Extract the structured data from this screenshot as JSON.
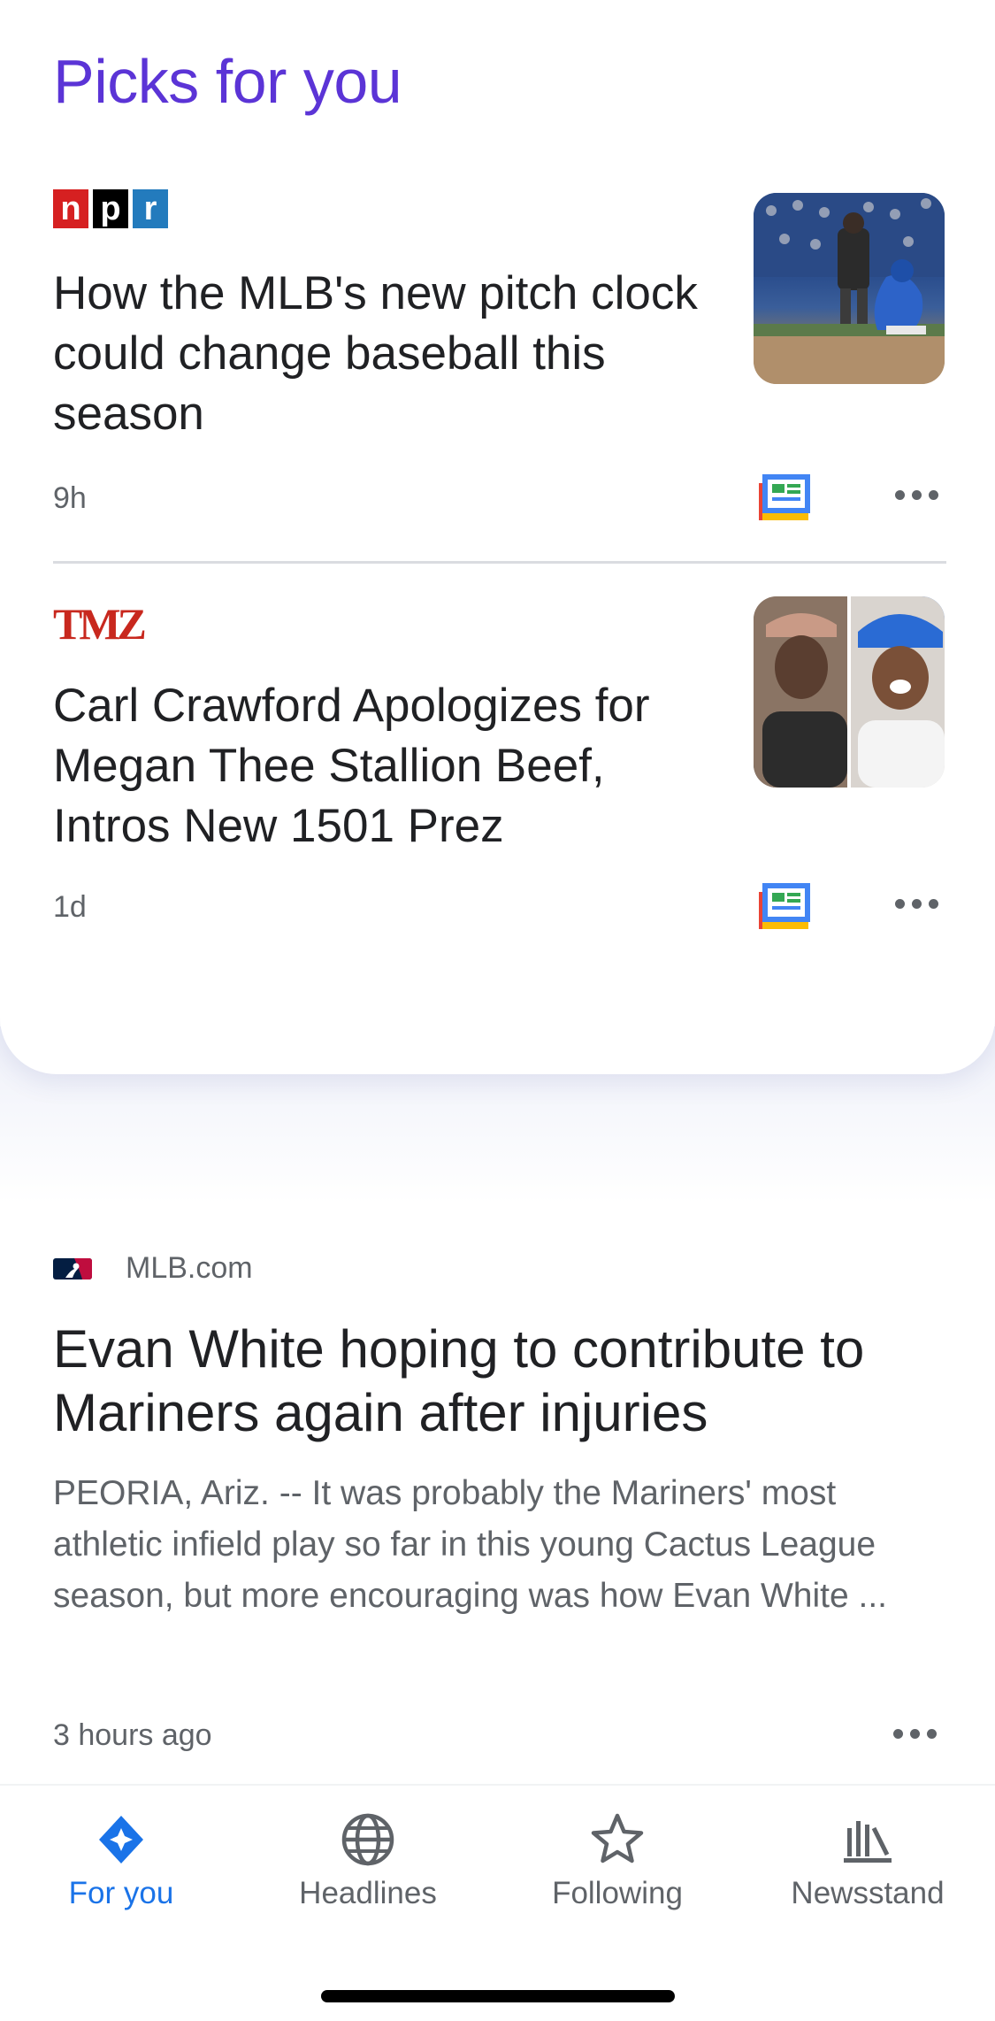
{
  "picks": {
    "title": "Picks for you",
    "stories": [
      {
        "source": "NPR",
        "source_logo_letters": [
          "n",
          "p",
          "r"
        ],
        "headline": "How the MLB's new pitch clock could change baseball this season",
        "time": "9h"
      },
      {
        "source": "TMZ",
        "source_logo_text": "TMZ",
        "headline": "Carl Crawford Apologizes for Megan Thee Stallion Beef, Intros New 1501 Prez",
        "time": "1d"
      }
    ]
  },
  "feature": {
    "source": "MLB.com",
    "headline": "Evan White hoping to contribute to Mariners again after injuries",
    "snippet": "PEORIA, Ariz. -- It was probably the Mariners' most athletic infield play so far in this young Cactus League season, but more encouraging was how Evan White ...",
    "time": "3 hours ago"
  },
  "bottom_nav": {
    "items": [
      {
        "label": "For you",
        "icon": "for-you-diamond-icon",
        "active": true
      },
      {
        "label": "Headlines",
        "icon": "globe-icon",
        "active": false
      },
      {
        "label": "Following",
        "icon": "star-icon",
        "active": false
      },
      {
        "label": "Newsstand",
        "icon": "newsstand-bars-icon",
        "active": false
      }
    ]
  },
  "colors": {
    "accent_purple": "#5b34d6",
    "active_blue": "#1a73e8",
    "text_primary": "#202124",
    "text_secondary": "#5f6368",
    "npr_red": "#d62021",
    "npr_blue": "#237bbd",
    "tmz_red": "#c8281e"
  }
}
